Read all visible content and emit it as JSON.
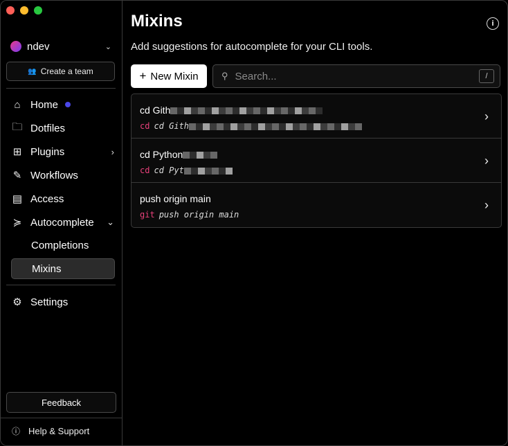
{
  "window": {
    "traffic_colors": [
      "#ff5f57",
      "#febc2e",
      "#28c840"
    ]
  },
  "user": {
    "name": "ndev",
    "chevron_icon": "chevron-down-icon"
  },
  "sidebar": {
    "create_team_label": "Create a team",
    "items": [
      {
        "label": "Home",
        "icon": "home-icon",
        "badge_color": "#4a47e8"
      },
      {
        "label": "Dotfiles",
        "icon": "folder-icon"
      },
      {
        "label": "Plugins",
        "icon": "plugins-icon"
      },
      {
        "label": "Workflows",
        "icon": "edit-icon"
      },
      {
        "label": "Access",
        "icon": "server-icon"
      },
      {
        "label": "Autocomplete",
        "icon": "terminal-icon"
      }
    ],
    "subitems": [
      {
        "label": "Completions"
      },
      {
        "label": "Mixins",
        "active": true
      }
    ],
    "settings_label": "Settings",
    "feedback_label": "Feedback",
    "help_label": "Help & Support"
  },
  "main": {
    "title": "Mixins",
    "subtitle": "Add suggestions for autocomplete for your CLI tools.",
    "new_mixin_label": "New Mixin",
    "search_placeholder": "Search...",
    "search_shortcut": "/"
  },
  "mixins": [
    {
      "name": "cd Gith",
      "tool": "cd",
      "args": "cd Gith",
      "redacted": true
    },
    {
      "name": "cd Python",
      "tool": "cd",
      "args": "cd Pyt",
      "redacted": true
    },
    {
      "name": "push origin main",
      "tool": "git",
      "args": "push origin main",
      "redacted": false
    }
  ]
}
